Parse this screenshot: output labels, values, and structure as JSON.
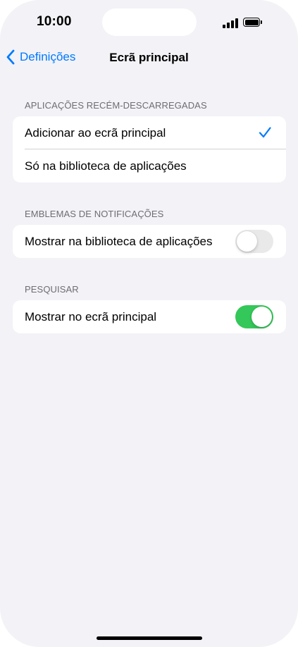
{
  "status_bar": {
    "time": "10:00"
  },
  "nav": {
    "back_label": "Definições",
    "title": "Ecrã principal"
  },
  "sections": [
    {
      "header": "APLICAÇÕES RECÉM-DESCARREGADAS",
      "rows": [
        {
          "label": "Adicionar ao ecrã principal",
          "selected": true
        },
        {
          "label": "Só na biblioteca de aplicações",
          "selected": false
        }
      ]
    },
    {
      "header": "EMBLEMAS DE NOTIFICAÇÕES",
      "rows": [
        {
          "label": "Mostrar na biblioteca de aplicações",
          "toggle": false
        }
      ]
    },
    {
      "header": "PESQUISAR",
      "rows": [
        {
          "label": "Mostrar no ecrã principal",
          "toggle": true
        }
      ]
    }
  ],
  "colors": {
    "accent": "#007aff",
    "toggle_on": "#34c759",
    "toggle_off": "#e9e9ea",
    "background": "#f2f2f7"
  }
}
